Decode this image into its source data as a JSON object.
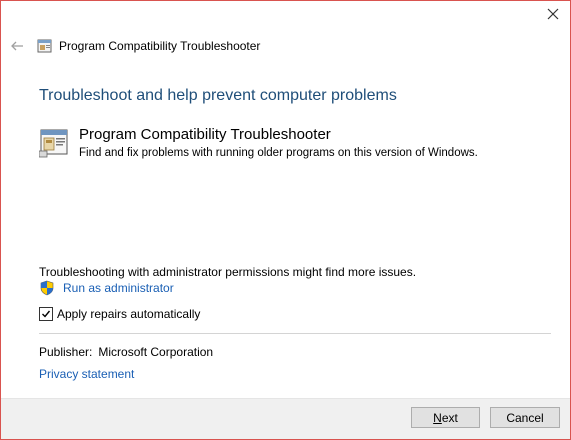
{
  "window": {
    "title": "Program Compatibility Troubleshooter"
  },
  "main": {
    "heading": "Troubleshoot and help prevent computer problems",
    "option": {
      "title": "Program Compatibility Troubleshooter",
      "description": "Find and fix problems with running older programs on this version of Windows."
    },
    "admin_note": "Troubleshooting with administrator permissions might find more issues.",
    "run_as_admin_label": "Run as administrator",
    "apply_repairs": {
      "label": "Apply repairs automatically",
      "checked": true
    },
    "publisher": {
      "label": "Publisher:",
      "value": "Microsoft Corporation"
    },
    "privacy_label": "Privacy statement"
  },
  "footer": {
    "next_label": "Next",
    "cancel_label": "Cancel"
  },
  "icons": {
    "close": "close-icon",
    "back": "back-arrow-icon",
    "app": "program-compatibility-icon",
    "shield": "uac-shield-icon",
    "check": "checkmark-icon"
  },
  "colors": {
    "heading": "#1f4e79",
    "link": "#1a5fb4",
    "window_border": "#d9534f",
    "footer_bg": "#f0f0f0"
  }
}
